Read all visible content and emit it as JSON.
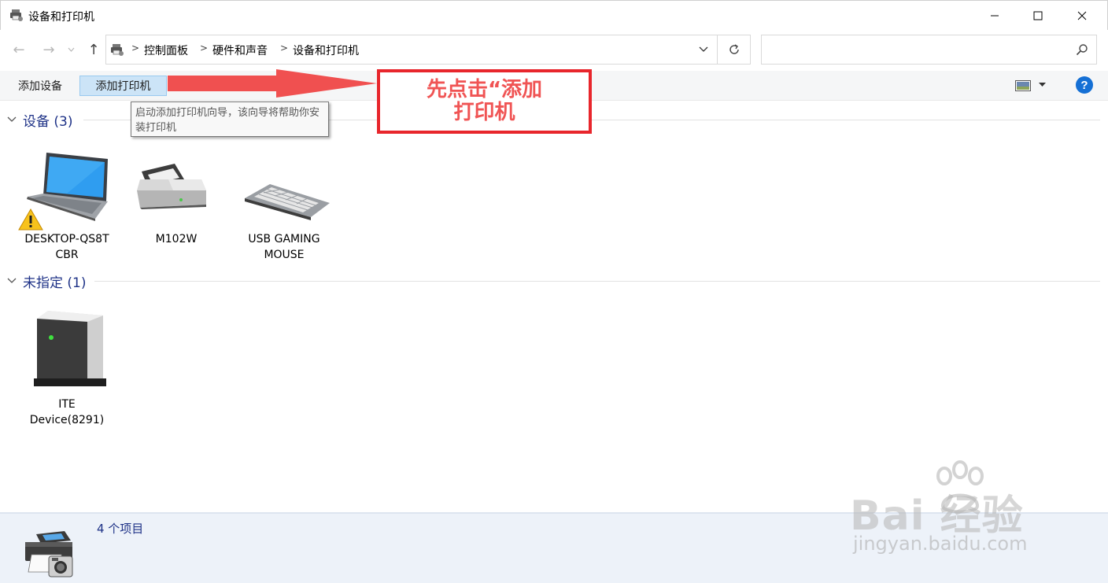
{
  "window": {
    "title": "设备和打印机"
  },
  "address": {
    "crumbs": [
      "控制面板",
      "硬件和声音",
      "设备和打印机"
    ],
    "search_placeholder": ""
  },
  "commands": {
    "add_device": "添加设备",
    "add_printer": "添加打印机"
  },
  "tooltip": {
    "text": "启动添加打印机向导，该向导将帮助你安装打印机"
  },
  "groups": [
    {
      "title": "设备 (3)",
      "devices": [
        {
          "name": "DESKTOP-QS8T\nCBR",
          "icon": "laptop-icon",
          "warning": true
        },
        {
          "name": "M102W",
          "icon": "scanner-printer-icon"
        },
        {
          "name": "USB GAMING\nMOUSE",
          "icon": "keyboard-icon"
        }
      ]
    },
    {
      "title": "未指定 (1)",
      "devices": [
        {
          "name": "ITE\nDevice(8291)",
          "icon": "generic-device-icon"
        }
      ]
    }
  ],
  "annotation": {
    "text": "先点击“添加\n打印机",
    "color": "#e8262c"
  },
  "status": {
    "count_text": "4 个项目"
  },
  "watermark": {
    "main": "Bai  经验",
    "sub": "jingyan.baidu.com"
  },
  "colors": {
    "accent": "#1e3287",
    "selection": "#cce4f7",
    "help": "#1570d5"
  }
}
